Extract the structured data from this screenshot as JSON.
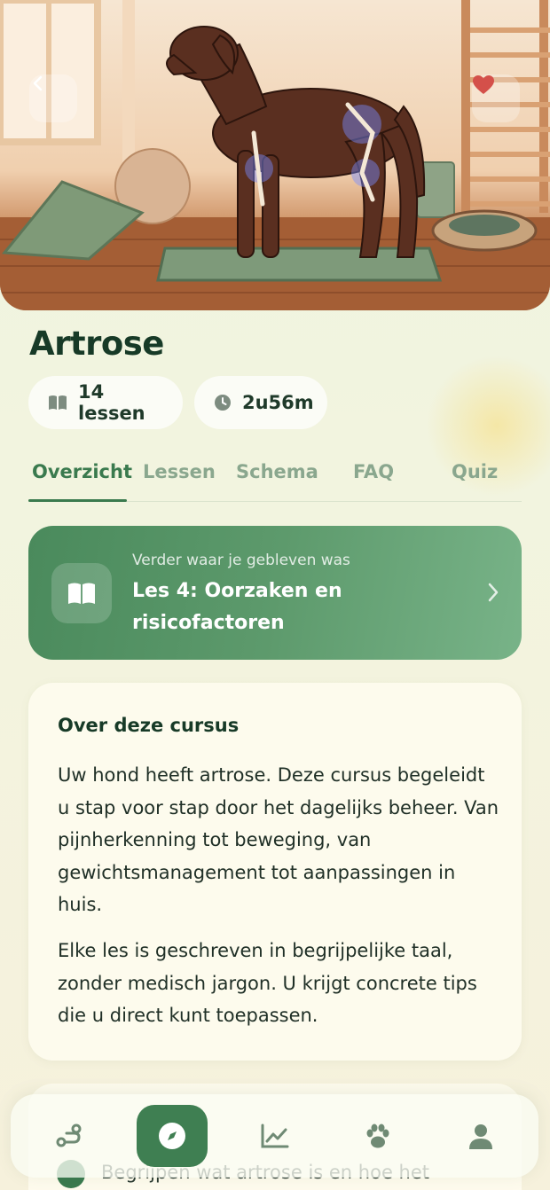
{
  "course": {
    "title": "Artrose",
    "lessons_count": "14 lessen",
    "duration": "2u56m"
  },
  "tabs": [
    "Overzicht",
    "Lessen",
    "Schema",
    "FAQ",
    "Quiz"
  ],
  "continue_card": {
    "kicker": "Verder waar je gebleven was",
    "lesson_title": "Les 4: Oorzaken en risicofactoren"
  },
  "about": {
    "heading": "Over deze cursus",
    "paragraph_1": "Uw hond heeft artrose. Deze cursus begeleidt u stap voor stap door het dagelijks beheer. Van pijnherkenning tot beweging, van gewichtsmanagement tot aanpassingen in huis.",
    "paragraph_2": "Elke les is geschreven in begrijpelijke taal, zonder medisch jargon. U krijgt concrete tips die u direct kunt toepassen."
  },
  "goals": {
    "first_item": "Begrijpen wat artrose is en hoe het"
  },
  "nav": [
    "route-icon",
    "compass-icon",
    "chart-icon",
    "paw-icon",
    "user-icon"
  ],
  "colors": {
    "primary": "#3f7f52",
    "tab_inactive": "#8aa78e",
    "title": "#173a27",
    "favorite": "#d4504a"
  }
}
